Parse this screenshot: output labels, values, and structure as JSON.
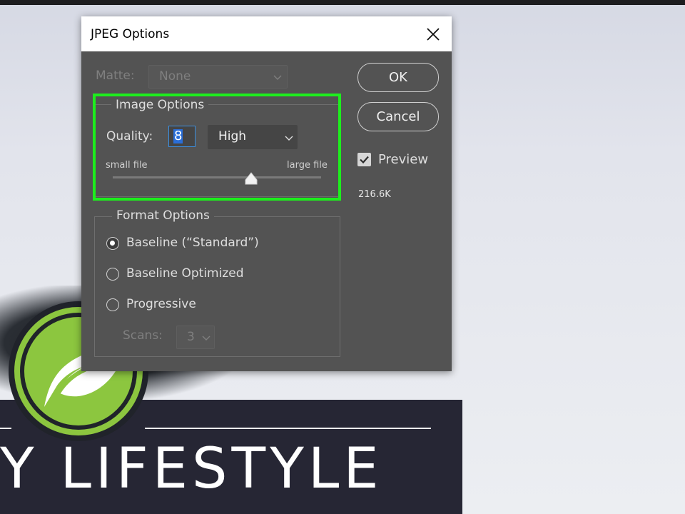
{
  "dialog": {
    "title": "JPEG Options",
    "matte": {
      "label": "Matte:",
      "value": "None"
    },
    "image_options": {
      "legend": "Image Options",
      "quality_label": "Quality:",
      "quality_value": "8",
      "quality_preset": "High",
      "small_file_label": "small file",
      "large_file_label": "large file",
      "slider_fraction": 0.66
    },
    "format_options": {
      "legend": "Format Options",
      "options": [
        {
          "label": "Baseline (“Standard”)",
          "checked": true
        },
        {
          "label": "Baseline Optimized",
          "checked": false
        },
        {
          "label": "Progressive",
          "checked": false
        }
      ],
      "scans_label": "Scans:",
      "scans_value": "3"
    },
    "buttons": {
      "ok": "OK",
      "cancel": "Cancel"
    },
    "preview": {
      "label": "Preview",
      "checked": true
    },
    "file_size": "216.6K"
  },
  "background": {
    "banner_text": "Y LIFESTYLE"
  },
  "colors": {
    "dialog_bg": "#535353",
    "highlight": "#1dee1d",
    "banner": "#262634",
    "logo_green": "#8cc63f"
  }
}
